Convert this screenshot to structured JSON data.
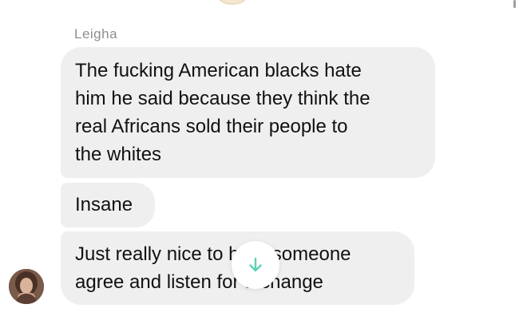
{
  "conversation": {
    "sender_name": "Leigha",
    "messages": [
      {
        "lines": [
          "The fucking American blacks hate",
          "him he said because they think the",
          "real Africans sold their people to",
          "the whites"
        ]
      },
      {
        "lines": [
          "Insane"
        ]
      },
      {
        "lines": [
          "Just really nice to hear someone",
          "agree and listen for a change"
        ]
      }
    ]
  },
  "controls": {
    "scroll_down_icon": "arrow-down-icon",
    "accent_color": "#5ad1b4"
  },
  "colors": {
    "bubble_background": "#efefef",
    "sender_name": "#8e8e8e",
    "message_text": "#111111"
  }
}
